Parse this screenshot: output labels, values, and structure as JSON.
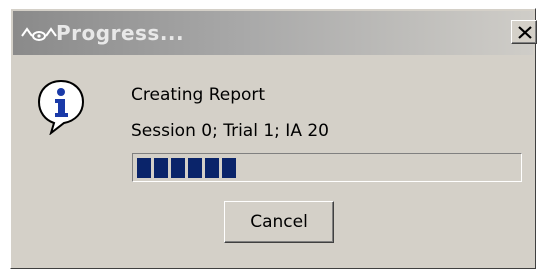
{
  "window": {
    "title": "Progress...",
    "app_icon": "waveform-eye-icon",
    "close_label": "×"
  },
  "message": {
    "icon": "info-icon",
    "line1": "Creating Report",
    "line2": "Session 0; Trial 1; IA 20"
  },
  "progress": {
    "fraction": 0.2,
    "filled_blocks": 6,
    "color": "#0a246a"
  },
  "buttons": {
    "cancel_label": "Cancel"
  }
}
